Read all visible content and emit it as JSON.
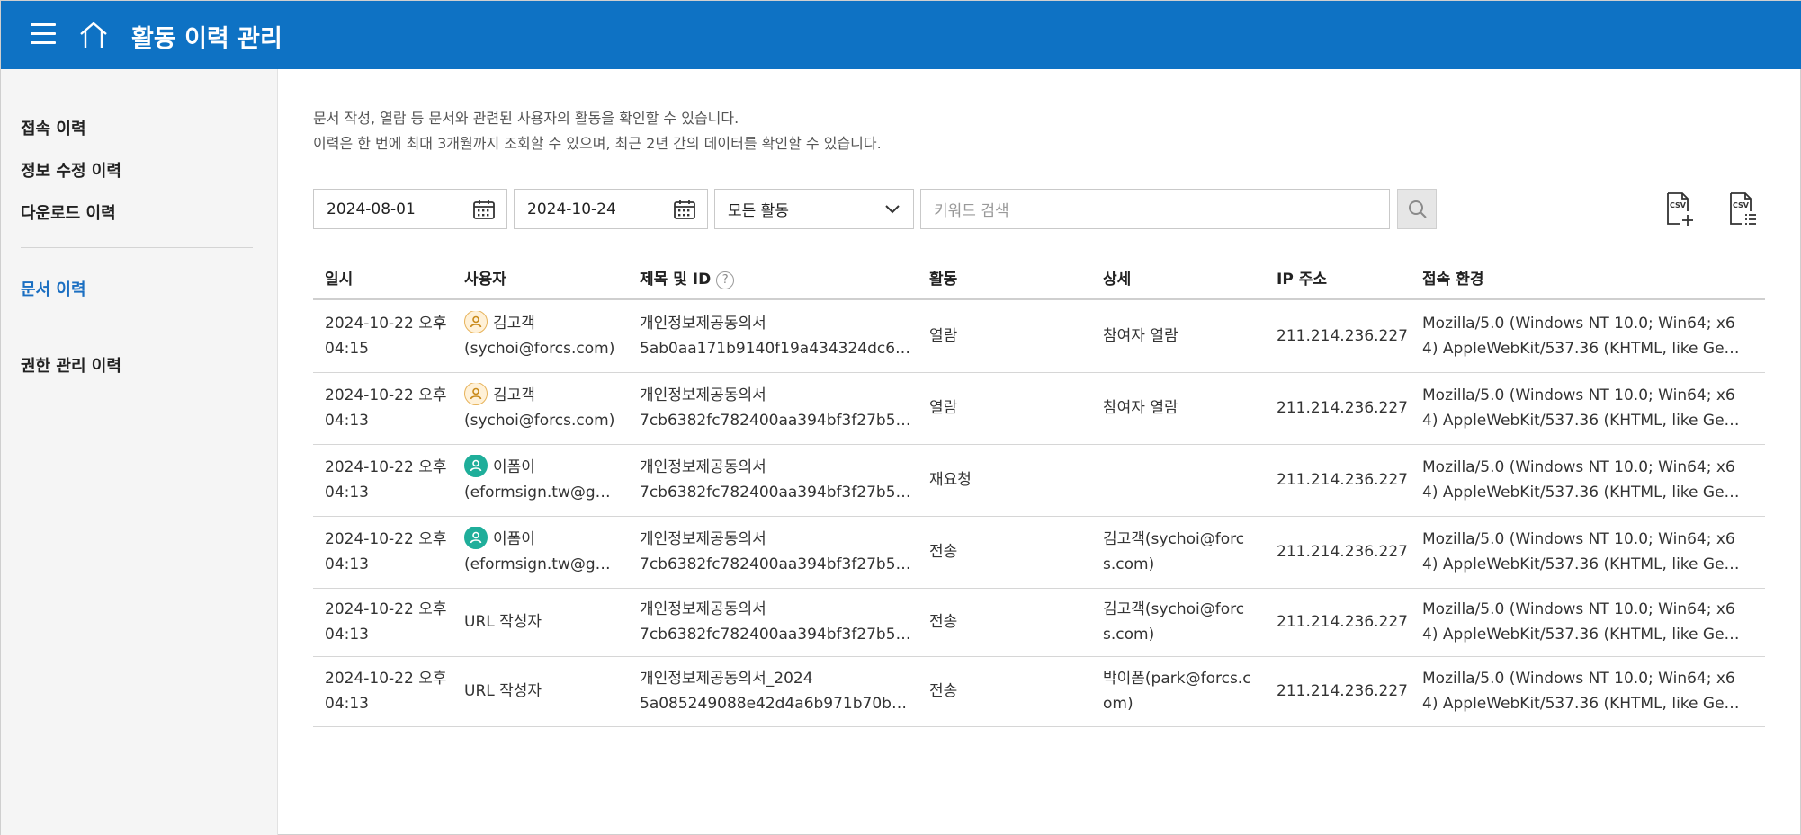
{
  "header": {
    "title": "활동 이력 관리"
  },
  "sidebar": {
    "items": [
      {
        "label": "접속 이력",
        "active": false
      },
      {
        "label": "정보 수정 이력",
        "active": false
      },
      {
        "label": "다운로드 이력",
        "active": false
      },
      {
        "label": "문서 이력",
        "active": true
      },
      {
        "label": "권한 관리 이력",
        "active": false
      }
    ]
  },
  "description": {
    "line1": "문서 작성, 열람 등 문서와 관련된 사용자의 활동을 확인할 수 있습니다.",
    "line2": "이력은 한 번에 최대 3개월까지 조회할 수 있으며, 최근 2년 간의 데이터를 확인할 수 있습니다."
  },
  "filters": {
    "start_date": "2024-08-01",
    "end_date": "2024-10-24",
    "activity_select": "모든 활동",
    "search_placeholder": "키워드 검색"
  },
  "table": {
    "columns": [
      "일시",
      "사용자",
      "제목 및 ID",
      "활동",
      "상세",
      "IP 주소",
      "접속 환경"
    ],
    "rows": [
      {
        "date1": "2024-10-22 오후",
        "date2": "04:15",
        "avatar": "yellow",
        "user_name": "김고객",
        "user_email": "(sychoi@forcs.com)",
        "title": "개인정보제공동의서",
        "doc_id": "5ab0aa171b9140f19a434324dc6…",
        "activity": "열람",
        "detail1": "참여자 열람",
        "detail2": "",
        "ip": "211.214.236.227",
        "env1": "Mozilla/5.0 (Windows NT 10.0; Win64; x6",
        "env2": "4) AppleWebKit/537.36 (KHTML, like Ge…"
      },
      {
        "date1": "2024-10-22 오후",
        "date2": "04:13",
        "avatar": "yellow",
        "user_name": "김고객",
        "user_email": "(sychoi@forcs.com)",
        "title": "개인정보제공동의서",
        "doc_id": "7cb6382fc782400aa394bf3f27b5…",
        "activity": "열람",
        "detail1": "참여자 열람",
        "detail2": "",
        "ip": "211.214.236.227",
        "env1": "Mozilla/5.0 (Windows NT 10.0; Win64; x6",
        "env2": "4) AppleWebKit/537.36 (KHTML, like Ge…"
      },
      {
        "date1": "2024-10-22 오후",
        "date2": "04:13",
        "avatar": "green",
        "user_name": "이폼이",
        "user_email": "(eformsign.tw@g…",
        "title": "개인정보제공동의서",
        "doc_id": "7cb6382fc782400aa394bf3f27b5…",
        "activity": "재요청",
        "detail1": "",
        "detail2": "",
        "ip": "211.214.236.227",
        "env1": "Mozilla/5.0 (Windows NT 10.0; Win64; x6",
        "env2": "4) AppleWebKit/537.36 (KHTML, like Ge…"
      },
      {
        "date1": "2024-10-22 오후",
        "date2": "04:13",
        "avatar": "green",
        "user_name": "이폼이",
        "user_email": "(eformsign.tw@g…",
        "title": "개인정보제공동의서",
        "doc_id": "7cb6382fc782400aa394bf3f27b5…",
        "activity": "전송",
        "detail1": "김고객(sychoi@forc",
        "detail2": "s.com)",
        "ip": "211.214.236.227",
        "env1": "Mozilla/5.0 (Windows NT 10.0; Win64; x6",
        "env2": "4) AppleWebKit/537.36 (KHTML, like Ge…"
      },
      {
        "date1": "2024-10-22 오후",
        "date2": "04:13",
        "avatar": "",
        "user_name": "URL 작성자",
        "user_email": "",
        "title": "개인정보제공동의서",
        "doc_id": "7cb6382fc782400aa394bf3f27b5…",
        "activity": "전송",
        "detail1": "김고객(sychoi@forc",
        "detail2": "s.com)",
        "ip": "211.214.236.227",
        "env1": "Mozilla/5.0 (Windows NT 10.0; Win64; x6",
        "env2": "4) AppleWebKit/537.36 (KHTML, like Ge…"
      },
      {
        "date1": "2024-10-22 오후",
        "date2": "04:13",
        "avatar": "",
        "user_name": "URL 작성자",
        "user_email": "",
        "title": "개인정보제공동의서_2024",
        "doc_id": "5a085249088e42d4a6b971b70b…",
        "activity": "전송",
        "detail1": "박이폼(park@forcs.c",
        "detail2": "om)",
        "ip": "211.214.236.227",
        "env1": "Mozilla/5.0 (Windows NT 10.0; Win64; x6",
        "env2": "4) AppleWebKit/537.36 (KHTML, like Ge…"
      }
    ]
  },
  "colors": {
    "header_bg": "#0e72c4",
    "active_link": "#1b6fc2",
    "avatar_yellow": "#e7b35a",
    "avatar_green": "#1fae9a"
  },
  "icons": {
    "menu": "hamburger-icon",
    "home": "home-icon",
    "calendar": "calendar-icon",
    "dropdown": "chevron-down-icon",
    "search": "search-icon",
    "csv_add": "csv-add-icon",
    "csv_list": "csv-list-icon",
    "help": "help-icon",
    "user": "user-avatar-icon"
  }
}
